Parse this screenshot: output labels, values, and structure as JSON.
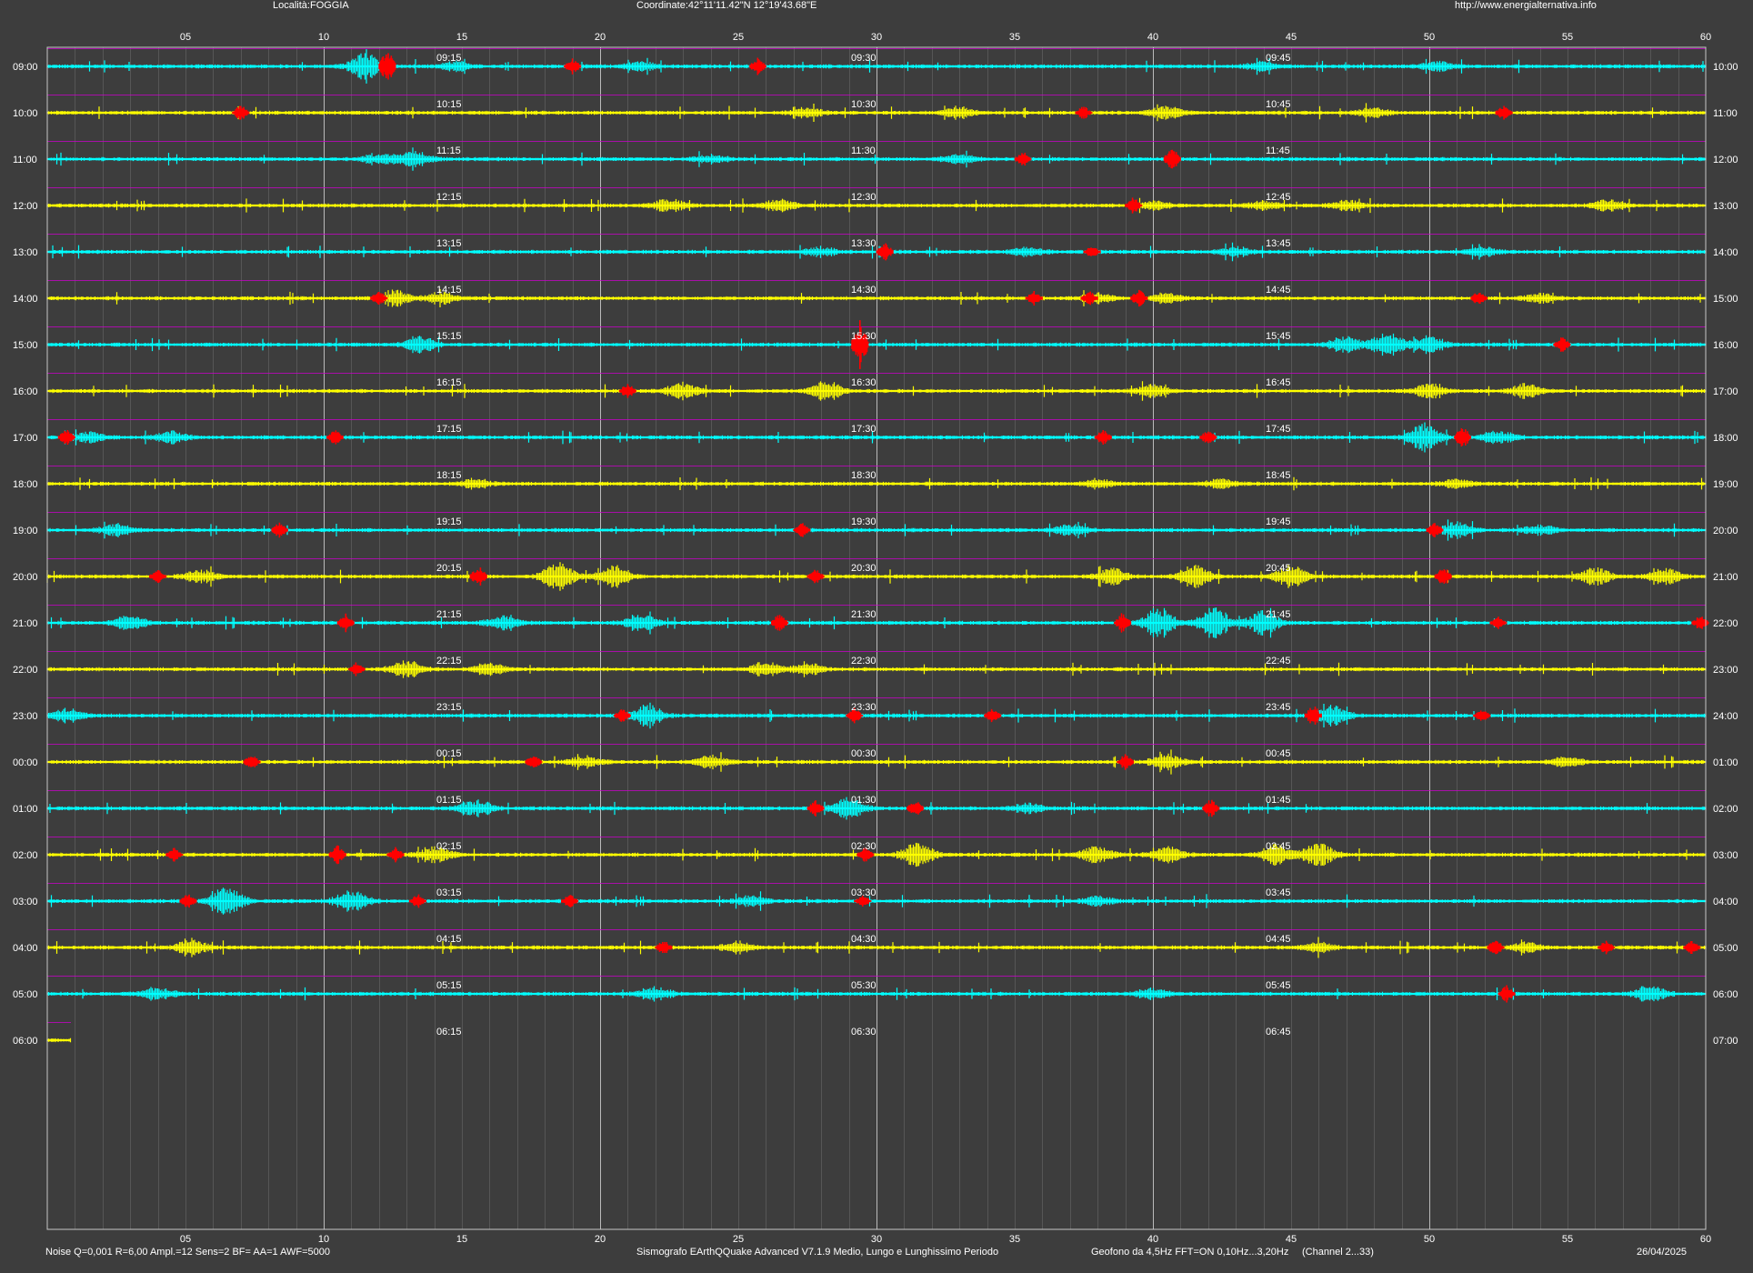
{
  "header": {
    "location": "Località:FOGGIA",
    "coordinates": "Coordinate:42°11'11.42\"N  12°19'43.68\"E",
    "website": "http://www.energialternativa.info"
  },
  "footer": {
    "settings": "Noise Q=0,001 R=6,00 Ampl.=12 Sens=2 BF= AA=1 AWF=5000",
    "software": "Sismografo  EArthQQuake Advanced V7.1.9  Medio, Lungo e Lunghissimo Periodo",
    "sensor": "Geofono da 4,5Hz FFT=ON 0,10Hz...3,20Hz",
    "channel": "(Channel 2...33)",
    "date": "26/04/2025"
  },
  "colors": {
    "background": "#3d3d3d",
    "plot_background": "#3d3d3d",
    "grid": "#8a8a8a",
    "grid_major": "#c8c8c8",
    "trace_a": "#00ffff",
    "trace_b": "#ffff00",
    "event": "#ff0000",
    "separator": "#cc00cc",
    "text": "#ffffff"
  },
  "chart_data": {
    "type": "line",
    "title": "",
    "xlabel": "",
    "ylabel": "",
    "x_ticks": [
      "05",
      "10",
      "15",
      "20",
      "25",
      "30",
      "35",
      "40",
      "45",
      "50",
      "55",
      "60"
    ],
    "xlim": [
      0,
      60
    ],
    "grid": true,
    "rows": [
      {
        "left": "09:00",
        "right": "10:00",
        "q": [
          "09:15",
          "09:30",
          "09:45"
        ],
        "color": "cyan",
        "progress": 1,
        "bursts": [
          [
            11.5,
            0.25
          ],
          [
            14.8,
            0.08
          ],
          [
            21.5,
            0.08
          ],
          [
            44,
            0.08
          ],
          [
            50.3,
            0.08
          ]
        ],
        "events": [
          [
            12.3,
            1
          ],
          [
            19,
            0.3
          ],
          [
            25.7,
            0.35
          ]
        ]
      },
      {
        "left": "10:00",
        "right": "11:00",
        "q": [
          "10:15",
          "10:30",
          "10:45"
        ],
        "color": "yellow",
        "progress": 1,
        "bursts": [
          [
            27.5,
            0.08
          ],
          [
            33,
            0.1
          ],
          [
            40.5,
            0.12
          ],
          [
            48,
            0.08
          ]
        ],
        "events": [
          [
            7,
            0.35
          ],
          [
            37.5,
            0.25
          ],
          [
            52.7,
            0.3
          ]
        ]
      },
      {
        "left": "11:00",
        "right": "12:00",
        "q": [
          "11:15",
          "11:30",
          "11:45"
        ],
        "color": "cyan",
        "progress": 1,
        "bursts": [
          [
            12,
            0.1
          ],
          [
            13.3,
            0.15
          ],
          [
            24,
            0.08
          ],
          [
            33,
            0.08
          ]
        ],
        "events": [
          [
            35.3,
            0.3
          ],
          [
            40.7,
            0.6
          ]
        ]
      },
      {
        "left": "12:00",
        "right": "13:00",
        "q": [
          "12:15",
          "12:30",
          "12:45"
        ],
        "color": "yellow",
        "progress": 1,
        "bursts": [
          [
            22.5,
            0.12
          ],
          [
            26.5,
            0.1
          ],
          [
            40,
            0.08
          ],
          [
            44,
            0.08
          ],
          [
            47,
            0.08
          ],
          [
            56.5,
            0.1
          ]
        ],
        "events": [
          [
            39.3,
            0.35
          ]
        ]
      },
      {
        "left": "13:00",
        "right": "14:00",
        "q": [
          "13:15",
          "13:30",
          "13:45"
        ],
        "color": "cyan",
        "progress": 1,
        "bursts": [
          [
            28,
            0.08
          ],
          [
            35.5,
            0.08
          ],
          [
            43,
            0.08
          ],
          [
            52,
            0.08
          ]
        ],
        "events": [
          [
            30.3,
            0.45
          ],
          [
            37.8,
            0.25
          ]
        ]
      },
      {
        "left": "14:00",
        "right": "15:00",
        "q": [
          "14:15",
          "14:30",
          "14:45"
        ],
        "color": "yellow",
        "progress": 1,
        "bursts": [
          [
            12.6,
            0.15
          ],
          [
            14.3,
            0.1
          ],
          [
            38,
            0.08
          ],
          [
            40.5,
            0.08
          ],
          [
            54,
            0.08
          ]
        ],
        "events": [
          [
            12,
            0.3
          ],
          [
            35.7,
            0.3
          ],
          [
            37.7,
            0.3
          ],
          [
            39.5,
            0.45
          ],
          [
            51.8,
            0.3
          ]
        ]
      },
      {
        "left": "15:00",
        "right": "16:00",
        "q": [
          "15:15",
          "15:30",
          "15:45"
        ],
        "color": "cyan",
        "progress": 1,
        "bursts": [
          [
            13.5,
            0.15
          ],
          [
            47,
            0.15
          ],
          [
            48.5,
            0.2
          ],
          [
            50,
            0.15
          ]
        ],
        "events": [
          [
            29.4,
            1.5
          ],
          [
            54.8,
            0.3
          ]
        ]
      },
      {
        "left": "16:00",
        "right": "17:00",
        "q": [
          "16:15",
          "16:30",
          "16:45"
        ],
        "color": "yellow",
        "progress": 1,
        "bursts": [
          [
            23,
            0.15
          ],
          [
            28.2,
            0.18
          ],
          [
            40,
            0.1
          ],
          [
            50,
            0.12
          ],
          [
            53.5,
            0.12
          ]
        ],
        "events": [
          [
            21,
            0.3
          ]
        ]
      },
      {
        "left": "17:00",
        "right": "18:00",
        "q": [
          "17:15",
          "17:30",
          "17:45"
        ],
        "color": "cyan",
        "progress": 1,
        "bursts": [
          [
            1.5,
            0.1
          ],
          [
            4.5,
            0.1
          ],
          [
            49.8,
            0.25
          ],
          [
            52.5,
            0.12
          ]
        ],
        "events": [
          [
            0.7,
            0.35
          ],
          [
            10.4,
            0.35
          ],
          [
            38.2,
            0.3
          ],
          [
            42,
            0.3
          ],
          [
            51.2,
            0.6
          ]
        ]
      },
      {
        "left": "18:00",
        "right": "19:00",
        "q": [
          "18:15",
          "18:30",
          "18:45"
        ],
        "color": "yellow",
        "progress": 1,
        "bursts": [
          [
            15.5,
            0.08
          ],
          [
            38,
            0.08
          ],
          [
            42.5,
            0.08
          ],
          [
            51,
            0.08
          ]
        ],
        "events": []
      },
      {
        "left": "19:00",
        "right": "20:00",
        "q": [
          "19:15",
          "19:30",
          "19:45"
        ],
        "color": "cyan",
        "progress": 1,
        "bursts": [
          [
            2.5,
            0.1
          ],
          [
            37,
            0.1
          ],
          [
            51,
            0.15
          ],
          [
            54,
            0.08
          ]
        ],
        "events": [
          [
            8.4,
            0.3
          ],
          [
            27.3,
            0.3
          ],
          [
            50.2,
            0.35
          ]
        ]
      },
      {
        "left": "20:00",
        "right": "21:00",
        "q": [
          "20:15",
          "20:30",
          "20:45"
        ],
        "color": "yellow",
        "progress": 1,
        "bursts": [
          [
            5.5,
            0.12
          ],
          [
            18.5,
            0.25
          ],
          [
            20.5,
            0.2
          ],
          [
            38.5,
            0.15
          ],
          [
            41.5,
            0.2
          ],
          [
            45,
            0.2
          ],
          [
            56,
            0.15
          ],
          [
            58.5,
            0.15
          ]
        ],
        "events": [
          [
            4,
            0.25
          ],
          [
            15.6,
            0.55
          ],
          [
            27.8,
            0.3
          ],
          [
            50.5,
            0.55
          ]
        ]
      },
      {
        "left": "21:00",
        "right": "22:00",
        "q": [
          "21:15",
          "21:30",
          "21:45"
        ],
        "color": "cyan",
        "progress": 1,
        "bursts": [
          [
            3,
            0.12
          ],
          [
            16.5,
            0.12
          ],
          [
            21.5,
            0.15
          ],
          [
            40.2,
            0.28
          ],
          [
            42.2,
            0.28
          ],
          [
            44,
            0.2
          ]
        ],
        "events": [
          [
            10.8,
            0.4
          ],
          [
            26.5,
            0.55
          ],
          [
            38.9,
            0.5
          ],
          [
            52.5,
            0.25
          ],
          [
            59.8,
            0.3
          ]
        ]
      },
      {
        "left": "22:00",
        "right": "23:00",
        "q": [
          "22:15",
          "22:30",
          "22:45"
        ],
        "color": "yellow",
        "progress": 1,
        "bursts": [
          [
            13,
            0.15
          ],
          [
            16,
            0.1
          ],
          [
            26,
            0.12
          ],
          [
            27.5,
            0.1
          ]
        ],
        "events": [
          [
            11.2,
            0.3
          ]
        ]
      },
      {
        "left": "23:00",
        "right": "24:00",
        "q": [
          "23:15",
          "23:30",
          "23:45"
        ],
        "color": "cyan",
        "progress": 1,
        "bursts": [
          [
            0.8,
            0.12
          ],
          [
            21.7,
            0.18
          ],
          [
            46.5,
            0.18
          ]
        ],
        "events": [
          [
            20.8,
            0.3
          ],
          [
            29.2,
            0.3
          ],
          [
            34.2,
            0.3
          ],
          [
            45.8,
            0.55
          ],
          [
            51.9,
            0.25
          ]
        ]
      },
      {
        "left": "00:00",
        "right": "01:00",
        "q": [
          "00:15",
          "00:30",
          "00:45"
        ],
        "color": "yellow",
        "progress": 1,
        "bursts": [
          [
            19.5,
            0.1
          ],
          [
            24,
            0.12
          ],
          [
            40.5,
            0.15
          ],
          [
            55,
            0.08
          ]
        ],
        "events": [
          [
            7.4,
            0.35
          ],
          [
            17.6,
            0.3
          ],
          [
            39,
            0.3
          ]
        ]
      },
      {
        "left": "01:00",
        "right": "02:00",
        "q": [
          "01:15",
          "01:30",
          "01:45"
        ],
        "color": "cyan",
        "progress": 1,
        "bursts": [
          [
            15.5,
            0.15
          ],
          [
            29,
            0.18
          ],
          [
            35.5,
            0.08
          ]
        ],
        "events": [
          [
            27.8,
            0.35
          ],
          [
            31.4,
            0.35
          ],
          [
            42.1,
            0.45
          ]
        ]
      },
      {
        "left": "02:00",
        "right": "03:00",
        "q": [
          "02:15",
          "02:30",
          "02:45"
        ],
        "color": "yellow",
        "progress": 1,
        "bursts": [
          [
            14,
            0.15
          ],
          [
            31.5,
            0.22
          ],
          [
            38,
            0.15
          ],
          [
            40.5,
            0.15
          ],
          [
            44.5,
            0.2
          ],
          [
            46,
            0.2
          ]
        ],
        "events": [
          [
            4.6,
            0.25
          ],
          [
            10.5,
            0.45
          ],
          [
            12.6,
            0.3
          ],
          [
            29.6,
            0.3
          ]
        ]
      },
      {
        "left": "03:00",
        "right": "04:00",
        "q": [
          "03:15",
          "03:30",
          "03:45"
        ],
        "color": "cyan",
        "progress": 1,
        "bursts": [
          [
            6.5,
            0.25
          ],
          [
            11,
            0.2
          ],
          [
            25.5,
            0.1
          ],
          [
            38,
            0.08
          ]
        ],
        "events": [
          [
            5.1,
            0.3
          ],
          [
            13.4,
            0.3
          ],
          [
            18.9,
            0.3
          ],
          [
            29.5,
            0.2
          ]
        ]
      },
      {
        "left": "04:00",
        "right": "05:00",
        "q": [
          "04:15",
          "04:30",
          "04:45"
        ],
        "color": "yellow",
        "progress": 1,
        "bursts": [
          [
            5.2,
            0.12
          ],
          [
            25,
            0.1
          ],
          [
            46,
            0.08
          ],
          [
            53.5,
            0.08
          ]
        ],
        "events": [
          [
            22.3,
            0.3
          ],
          [
            52.4,
            0.35
          ],
          [
            56.4,
            0.25
          ],
          [
            59.5,
            0.25
          ]
        ]
      },
      {
        "left": "05:00",
        "right": "06:00",
        "q": [
          "05:15",
          "05:30",
          "05:45"
        ],
        "color": "cyan",
        "progress": 1,
        "bursts": [
          [
            4,
            0.1
          ],
          [
            22,
            0.12
          ],
          [
            40,
            0.1
          ],
          [
            58,
            0.15
          ]
        ],
        "events": [
          [
            52.8,
            0.35
          ]
        ]
      },
      {
        "left": "06:00",
        "right": "07:00",
        "q": [
          "06:15",
          "06:30",
          "06:45"
        ],
        "color": "yellow",
        "progress": 0.014,
        "bursts": [],
        "events": []
      }
    ]
  }
}
